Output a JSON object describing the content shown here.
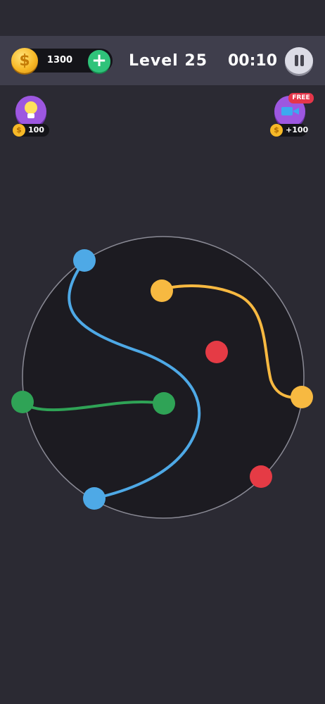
{
  "header": {
    "coins": "1300",
    "coin_icon_glyph": "$",
    "add_label": "+",
    "level": "Level 25",
    "timer": "00:10"
  },
  "hint": {
    "cost": "100"
  },
  "reward": {
    "badge": "FREE",
    "amount": "+100"
  },
  "board": {
    "rim_color": "#8a8a95",
    "fill_color": "#1c1b21",
    "dots": [
      {
        "color": "blue",
        "hex": "#4ea9e6",
        "state": "connected"
      },
      {
        "color": "blue",
        "hex": "#4ea9e6",
        "state": "connected"
      },
      {
        "color": "yellow",
        "hex": "#f7b941",
        "state": "connected"
      },
      {
        "color": "yellow",
        "hex": "#f7b941",
        "state": "connected"
      },
      {
        "color": "green",
        "hex": "#2fa356",
        "state": "connected"
      },
      {
        "color": "green",
        "hex": "#2fa356",
        "state": "connected"
      },
      {
        "color": "red",
        "hex": "#e53b45",
        "state": "unconnected"
      },
      {
        "color": "red",
        "hex": "#e53b45",
        "state": "unconnected"
      }
    ],
    "connections": [
      {
        "color": "blue",
        "hex": "#4ea9e6"
      },
      {
        "color": "yellow",
        "hex": "#f7b941"
      },
      {
        "color": "green",
        "hex": "#2fa356"
      }
    ]
  }
}
